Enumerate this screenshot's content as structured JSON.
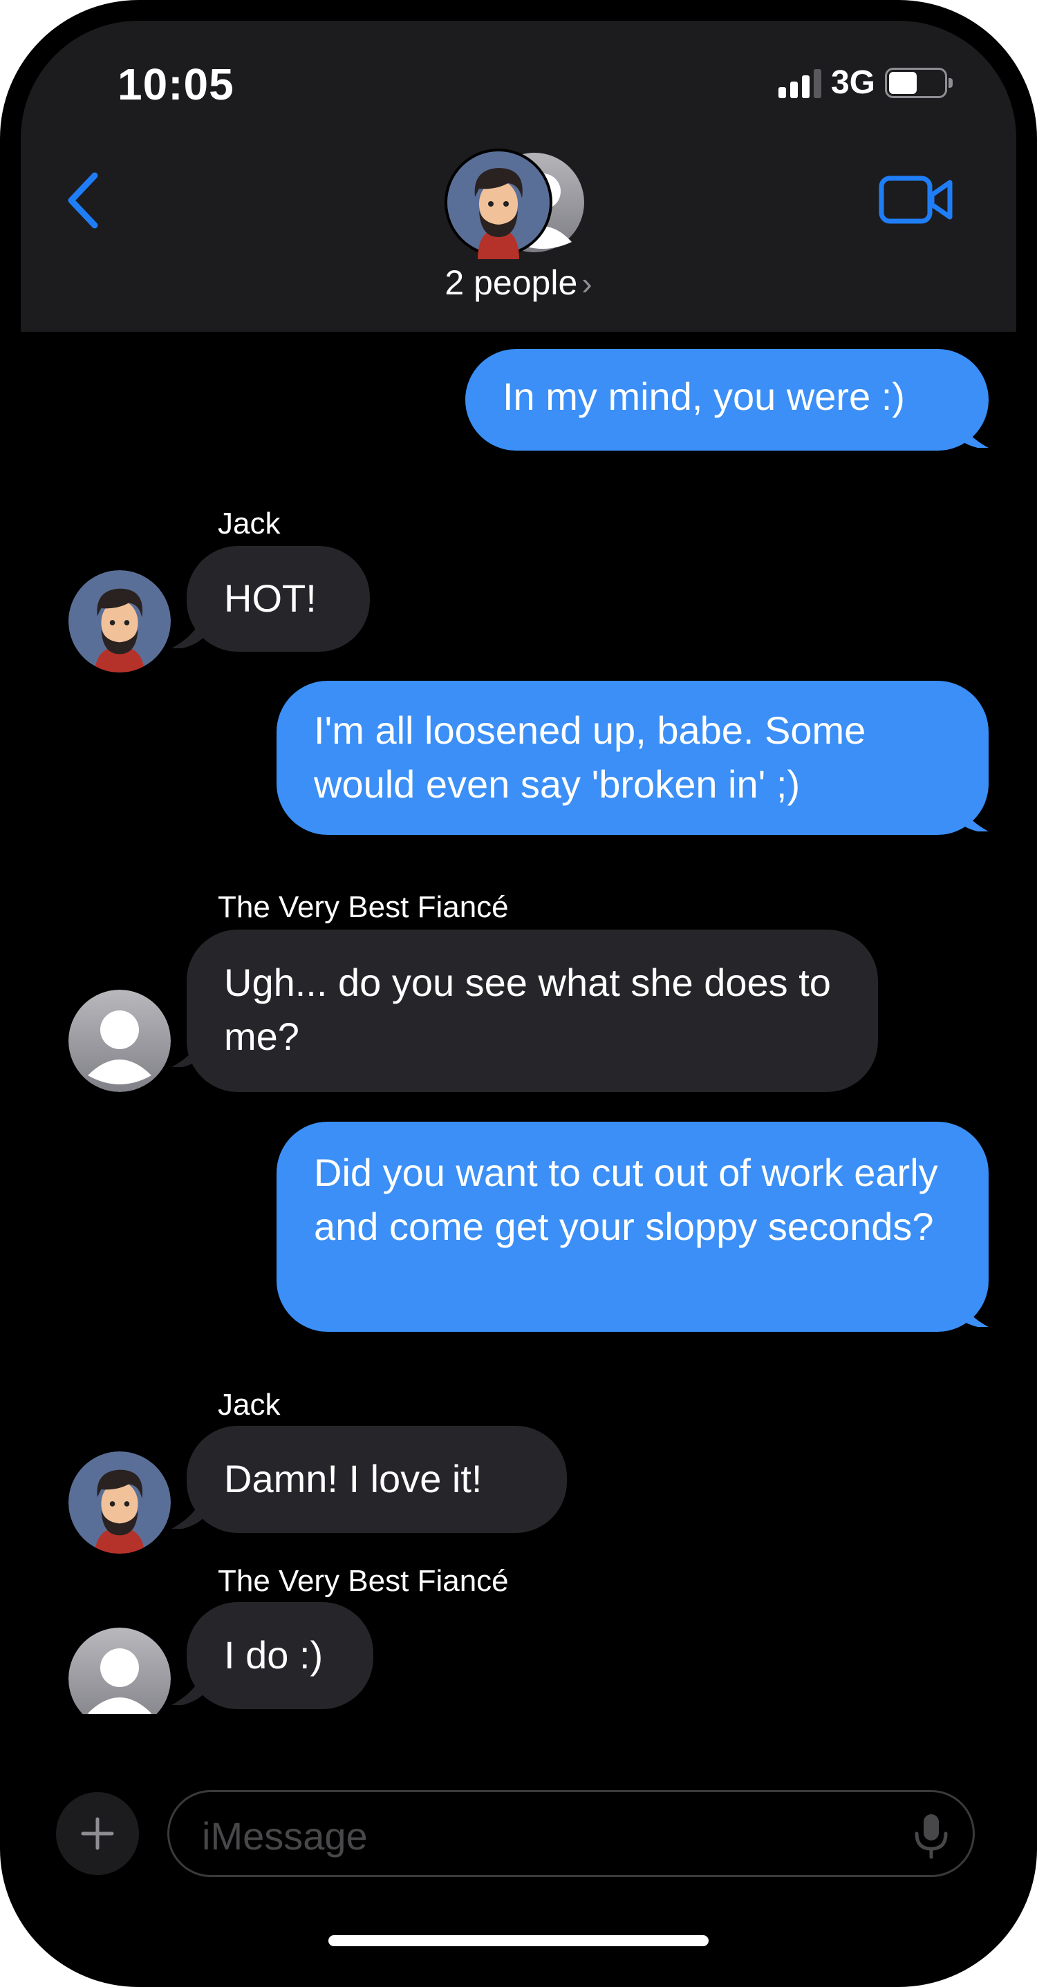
{
  "status_bar": {
    "time": "10:05",
    "network": "3G",
    "signal_bars_active": 3,
    "battery_level": 0.5
  },
  "header": {
    "group_label": "2 people",
    "back_icon": "chevron-left-icon",
    "video_icon": "video-camera-icon",
    "chevron_icon": "chevron-right-icon"
  },
  "messages": [
    {
      "direction": "out",
      "text": "In my mind, you were :)"
    },
    {
      "direction": "in",
      "sender": "Jack",
      "text": "HOT!"
    },
    {
      "direction": "out",
      "text": "I'm all loosened up, babe.  Some would even say 'broken in' ;)"
    },
    {
      "direction": "in",
      "sender": "The Very Best Fiancé",
      "text": "Ugh... do you see what she does to me?"
    },
    {
      "direction": "out",
      "text": "Did you want to cut out of work early and come get your sloppy seconds?"
    },
    {
      "direction": "in",
      "sender": "Jack",
      "text": "Damn!  I love it!"
    },
    {
      "direction": "in",
      "sender": "The Very Best Fiancé",
      "text": "I do :)"
    }
  ],
  "input_bar": {
    "placeholder": "iMessage",
    "value": "",
    "plus_icon": "plus-icon",
    "mic_icon": "microphone-icon"
  },
  "colors": {
    "outgoing_bubble": "#3b8ff6",
    "incoming_bubble": "#26262a",
    "accent": "#1f7ef6",
    "header_bg": "#1c1c1e"
  }
}
